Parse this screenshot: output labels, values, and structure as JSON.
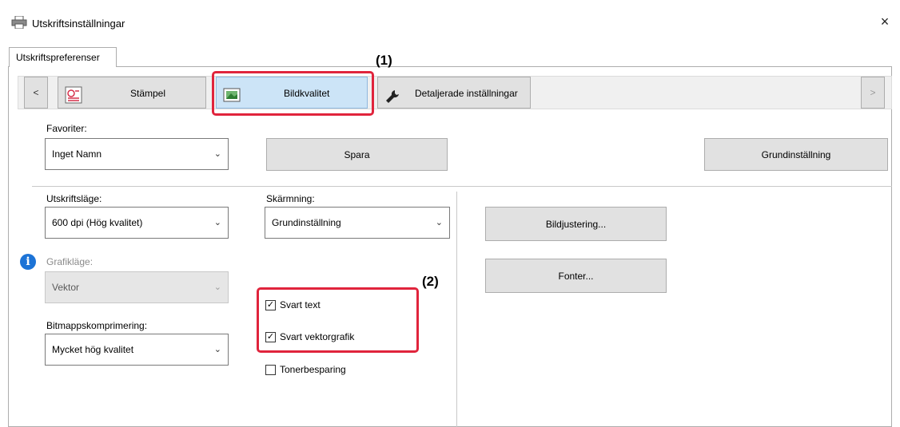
{
  "window": {
    "title": "Utskriftsinställningar",
    "close_glyph": "×",
    "printer_icon": "printer-icon"
  },
  "tab": {
    "label": "Utskriftspreferenser"
  },
  "nav": {
    "prev": "<",
    "next": ">",
    "items": [
      {
        "label": "Stämpel",
        "icon": "stamp-icon"
      },
      {
        "label": "Bildkvalitet",
        "icon": "image-quality-icon",
        "selected": true
      },
      {
        "label": "Detaljerade inställningar",
        "icon": "wrench-icon"
      }
    ]
  },
  "favorites": {
    "label": "Favoriter:",
    "value": "Inget Namn",
    "save": "Spara",
    "default": "Grundinställning"
  },
  "print_mode": {
    "label": "Utskriftsläge:",
    "value": "600 dpi (Hög kvalitet)"
  },
  "screening": {
    "label": "Skärmning:",
    "value": "Grundinställning"
  },
  "graphics_mode": {
    "label": "Grafikläge:",
    "value": "Vektor",
    "disabled": true
  },
  "bitmap": {
    "label": "Bitmappskomprimering:",
    "value": "Mycket hög kvalitet"
  },
  "checkboxes": [
    {
      "label": "Svart text",
      "checked": true
    },
    {
      "label": "Svart vektorgrafik",
      "checked": true
    },
    {
      "label": "Tonerbesparing",
      "checked": false
    }
  ],
  "buttons": {
    "image_adjust": "Bildjustering...",
    "fonts": "Fonter..."
  },
  "callouts": {
    "one": "(1)",
    "two": "(2)"
  },
  "colors": {
    "highlight": "#e0243c",
    "selected_tab": "#cce4f7",
    "info": "#1c73d6"
  }
}
